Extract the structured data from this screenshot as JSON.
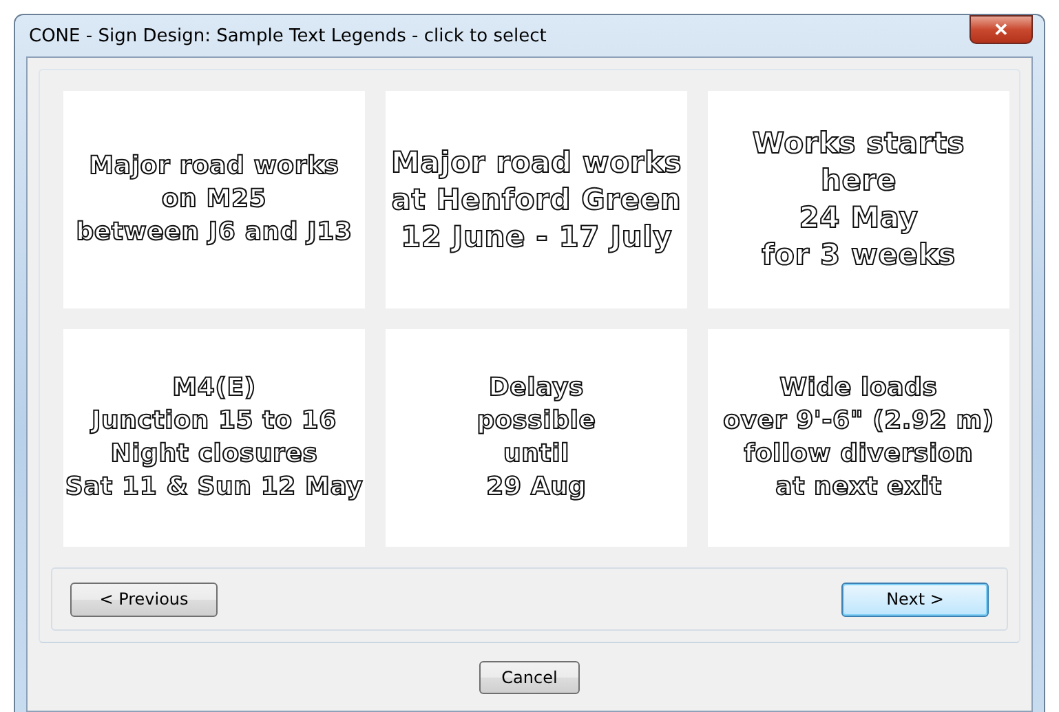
{
  "window": {
    "title": "CONE - Sign Design: Sample Text Legends - click to select",
    "close": "✕"
  },
  "signs": [
    {
      "lines": [
        "Major road works",
        "on M25",
        "between J6 and J13"
      ]
    },
    {
      "lines": [
        "Major road works",
        "at Henford Green",
        "12 June - 17 July"
      ]
    },
    {
      "lines": [
        "Works starts",
        "here",
        "24 May",
        "for 3 weeks"
      ]
    },
    {
      "lines": [
        "M4(E)",
        "Junction 15 to 16",
        "Night closures",
        "Sat 11 & Sun 12 May"
      ]
    },
    {
      "lines": [
        "Delays",
        "possible",
        "until",
        "29 Aug"
      ]
    },
    {
      "lines": [
        "Wide loads",
        "over 9'-6\" (2.92 m)",
        "follow diversion",
        "at next exit"
      ]
    }
  ],
  "nav": [
    {
      "label": "< Previous",
      "default": false
    },
    {
      "label": "Next >",
      "default": true
    }
  ],
  "cancel": "Cancel"
}
